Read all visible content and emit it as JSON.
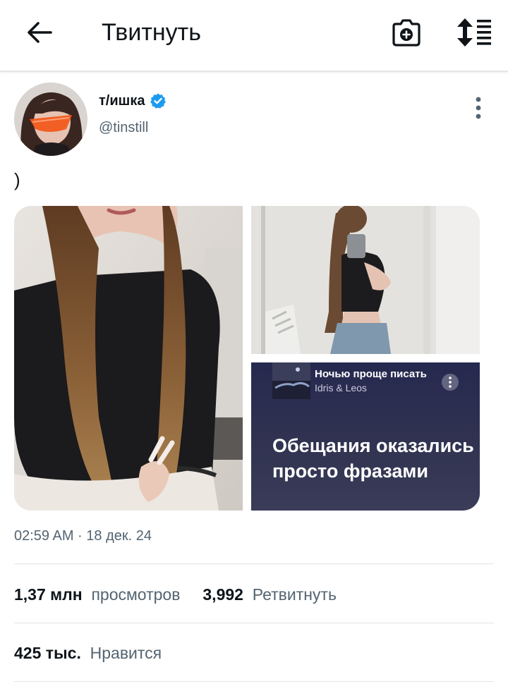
{
  "header": {
    "title": "Твитнуть",
    "back_icon": "arrow-left-icon",
    "camera_icon": "camera-plus-icon",
    "sort_icon": "sort-list-icon"
  },
  "tweet": {
    "author": {
      "name": "т/ишка",
      "handle": "@tinstill",
      "verified": true,
      "verified_color": "#1d9bf0"
    },
    "text": ")",
    "media": {
      "embed": {
        "song_title": "Ночью проще писать",
        "artist": "Idris & Leos",
        "lyric": "Обещания оказались просто фразами"
      }
    },
    "timestamp": "02:59 AM · 18 дек. 24"
  },
  "stats": {
    "views_count": "1,37 млн",
    "views_label": "просмотров",
    "retweets_count": "3,992",
    "retweets_label": "Ретвитнуть",
    "likes_count": "425 тыс.",
    "likes_label": "Нравится"
  }
}
